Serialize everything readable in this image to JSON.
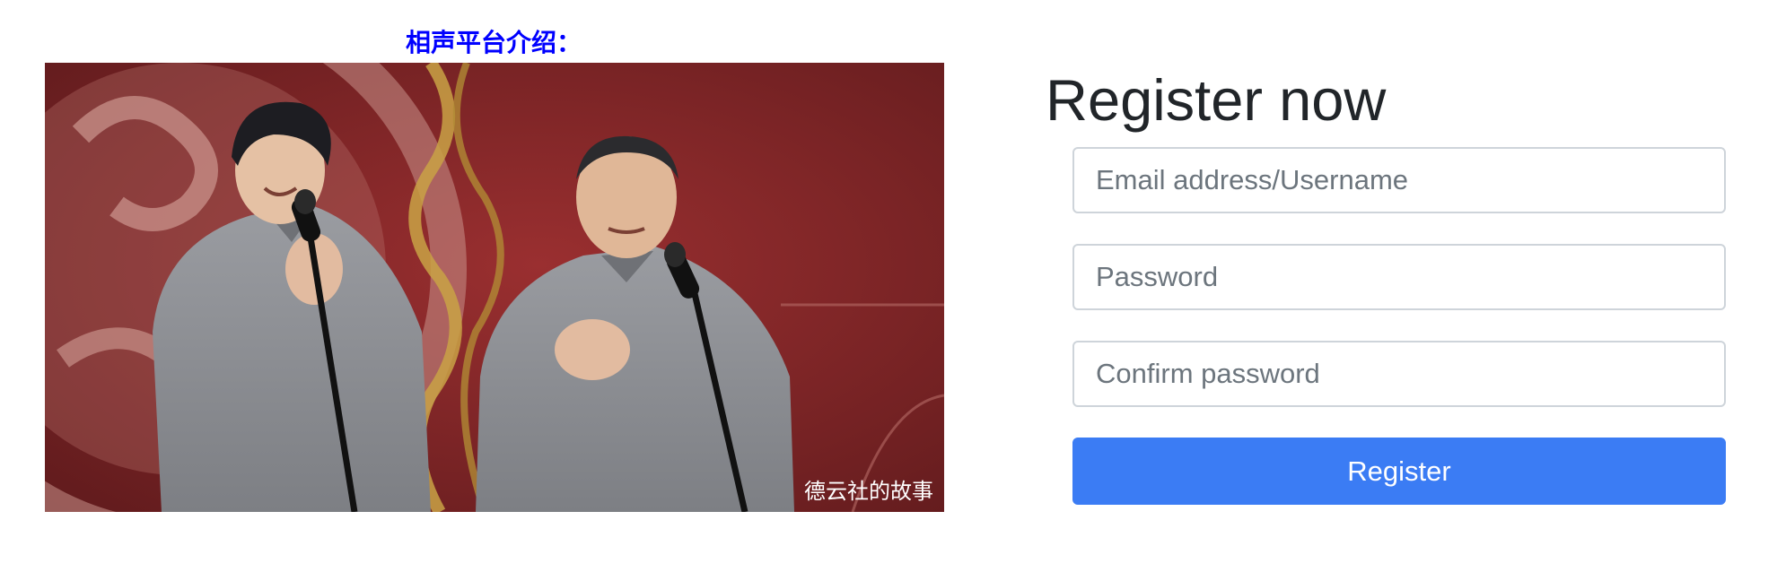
{
  "intro": {
    "heading": "相声平台介绍："
  },
  "photo": {
    "watermark": "德云社的故事",
    "subject": "two crosstalk performers in grey robes at microphones on a red stage"
  },
  "register": {
    "title": "Register now",
    "email_placeholder": "Email address/Username",
    "password_placeholder": "Password",
    "confirm_placeholder": "Confirm password",
    "button_label": "Register"
  },
  "colors": {
    "heading": "#0000ff",
    "button": "#3b7cf4",
    "field_border": "#ced4da",
    "stage_red": "#8a2a2a"
  }
}
